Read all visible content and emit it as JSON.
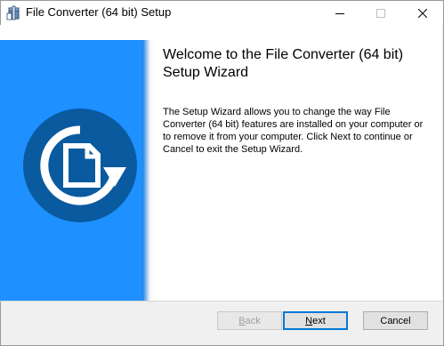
{
  "window": {
    "title": "File Converter (64 bit) Setup"
  },
  "main": {
    "heading": "Welcome to the File Converter (64 bit) Setup Wizard",
    "body": "The Setup Wizard allows you to change the way File Converter (64 bit) features are installed on your computer or to remove it from your computer. Click Next to continue or Cancel to exit the Setup Wizard."
  },
  "buttons": {
    "back_prefix": "",
    "back_mnemonic": "B",
    "back_rest": "ack",
    "next_mnemonic": "N",
    "next_rest": "ext",
    "cancel": "Cancel"
  },
  "colors": {
    "banner": "#1e90ff",
    "logo_circle": "#0a5aa0",
    "accent_border": "#0078d7"
  },
  "icons": {
    "app": "installer-package-icon",
    "minimize": "minimize-icon",
    "maximize": "maximize-icon",
    "close": "close-icon",
    "logo": "file-converter-logo"
  }
}
